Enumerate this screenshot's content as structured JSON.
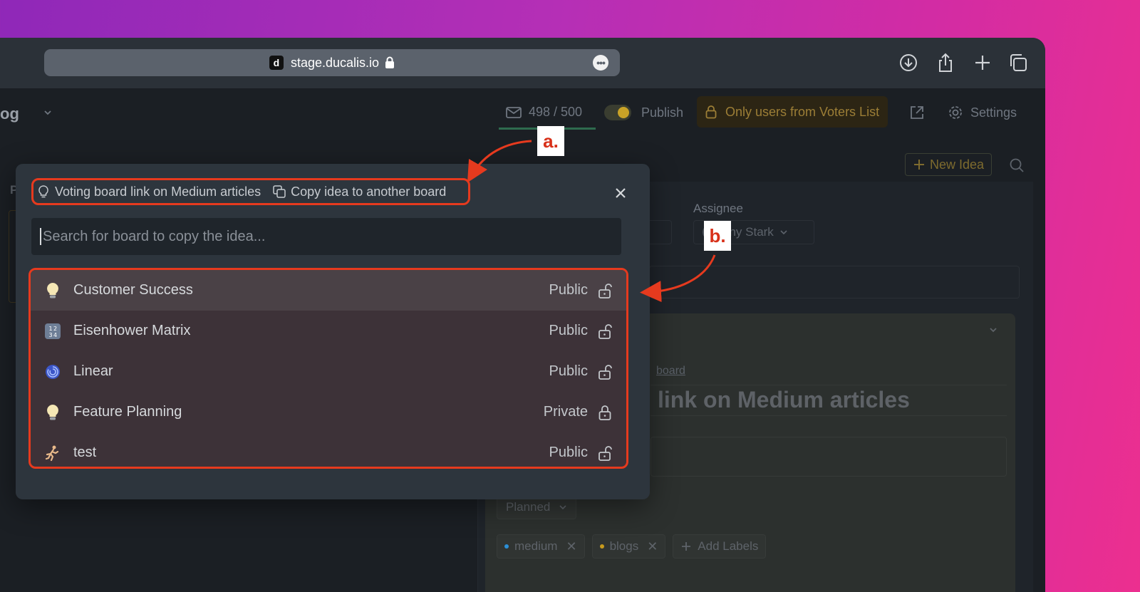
{
  "browser": {
    "favicon_letter": "d",
    "url": "stage.ducalis.io",
    "more_label": "•••"
  },
  "appbar": {
    "partial_title": "og",
    "counter": "498 / 500",
    "publish_label": "Publish",
    "voters_label": "Only users from Voters List",
    "settings_label": "Settings",
    "new_idea_label": "New Idea"
  },
  "detail": {
    "left_partial": "P",
    "assignee_label": "Assignee",
    "assignee_value": "ony Stark",
    "board_link": "board",
    "title_fragment": "link on Medium articles",
    "status": "Planned",
    "labels": [
      {
        "name": "medium",
        "color": "#2b8fd6"
      },
      {
        "name": "blogs",
        "color": "#c79a1d"
      }
    ],
    "add_labels": "Add Labels"
  },
  "modal": {
    "breadcrumb_idea": "Voting board link on Medium articles",
    "breadcrumb_action": "Copy idea to another board",
    "search_placeholder": "Search for board to copy the idea...",
    "boards": [
      {
        "name": "Customer Success",
        "visibility": "Public",
        "icon": "lightbulb-icon",
        "locked": false
      },
      {
        "name": "Eisenhower Matrix",
        "visibility": "Public",
        "icon": "numbers-icon",
        "locked": false
      },
      {
        "name": "Linear",
        "visibility": "Public",
        "icon": "cyclone-icon",
        "locked": false
      },
      {
        "name": "Feature Planning",
        "visibility": "Private",
        "icon": "lightbulb-icon",
        "locked": true
      },
      {
        "name": "test",
        "visibility": "Public",
        "icon": "runner-icon",
        "locked": false
      }
    ]
  },
  "annotations": {
    "a": "a.",
    "b": "b."
  },
  "colors": {
    "annotation_red": "#e63a1e",
    "modal_bg": "#2d353d",
    "list_bg": "#3d3238"
  }
}
